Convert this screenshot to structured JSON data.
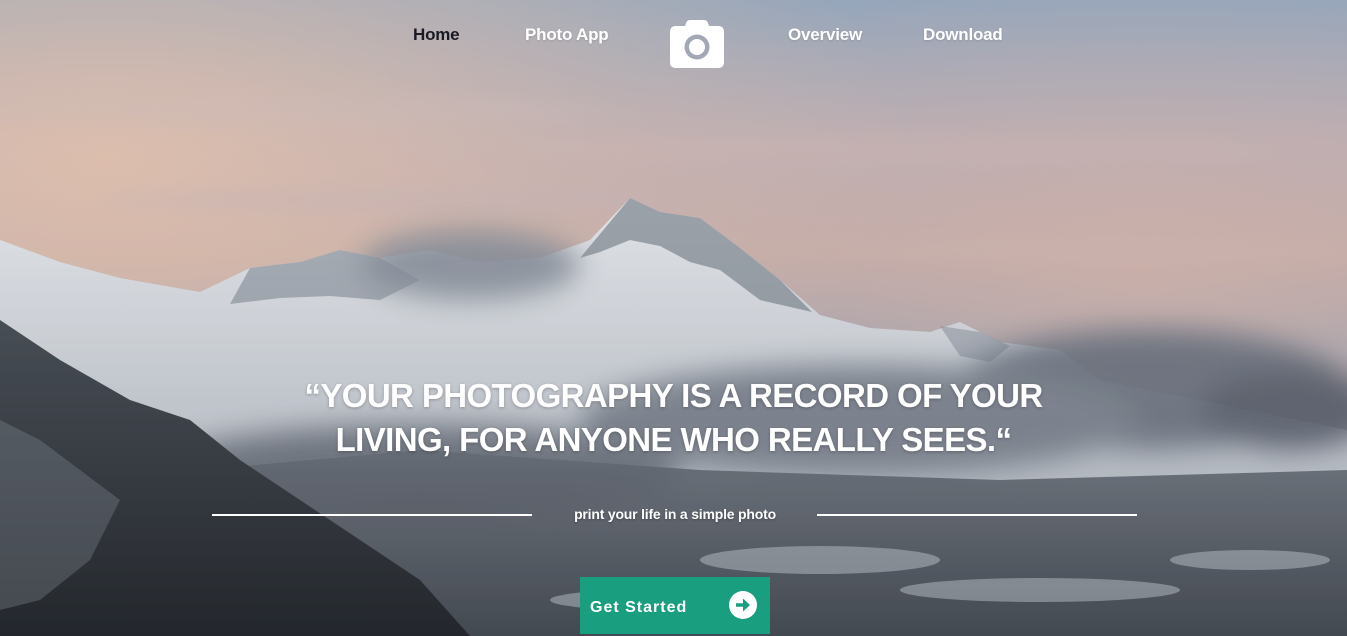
{
  "nav": {
    "items": [
      {
        "label": "Home",
        "active": true
      },
      {
        "label": "Photo App"
      },
      {
        "label": "Overview"
      },
      {
        "label": "Download"
      }
    ],
    "logo_icon": "camera-icon"
  },
  "hero": {
    "quote_line1": "“YOUR PHOTOGRAPHY IS A RECORD OF YOUR",
    "quote_line2": "LIVING, FOR ANYONE WHO REALLY SEES.“",
    "tagline": "print your life in a simple photo",
    "cta_label": "Get Started",
    "cta_icon": "arrow-right-circle-icon",
    "background": "snowy-mountain-photo"
  },
  "colors": {
    "accent": "#1a9e80",
    "active_nav": "#1a1a24",
    "text": "#ffffff"
  }
}
